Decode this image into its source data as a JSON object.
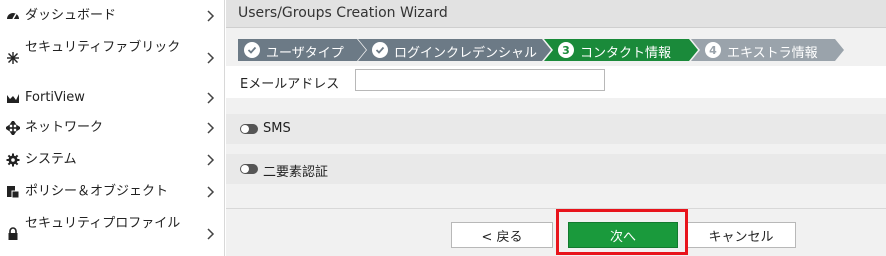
{
  "sidebar": {
    "items": [
      {
        "label": "ダッシュボード",
        "icon": "dashboard-icon"
      },
      {
        "label": "セキュリティファブリック",
        "icon": "fabric-icon"
      },
      {
        "label": "FortiView",
        "icon": "chart-icon"
      },
      {
        "label": "ネットワーク",
        "icon": "network-arrows-icon"
      },
      {
        "label": "システム",
        "icon": "gear-icon"
      },
      {
        "label": "ポリシー＆オブジェクト",
        "icon": "policy-icon"
      },
      {
        "label": "セキュリティプロファイル",
        "icon": "lock-icon"
      }
    ]
  },
  "header": {
    "title": "Users/Groups Creation Wizard"
  },
  "wizard": {
    "steps": [
      {
        "label": "ユーザタイプ",
        "state": "done"
      },
      {
        "label": "ログインクレデンシャル",
        "state": "done"
      },
      {
        "label": "コンタクト情報",
        "state": "active",
        "number": "3"
      },
      {
        "label": "エキストラ情報",
        "state": "pending",
        "number": "4"
      }
    ]
  },
  "form": {
    "email_label": "Eメールアドレス",
    "email_value": "",
    "sms_label": "SMS",
    "twofactor_label": "二要素認証"
  },
  "footer": {
    "back_label": "< 戻る",
    "next_label": "次へ",
    "cancel_label": "キャンセル"
  },
  "colors": {
    "step_done": "#6c7a86",
    "step_active": "#1a8a3a",
    "step_pending": "#9aa3ab",
    "primary_button": "#1a9a3c",
    "highlight": "#e8141c"
  }
}
